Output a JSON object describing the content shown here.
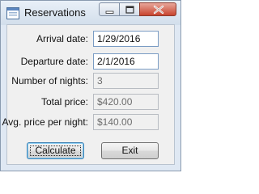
{
  "window": {
    "title": "Reservations"
  },
  "icons": {
    "app": "form-icon",
    "minimize": "minimize-icon",
    "maximize": "maximize-icon",
    "close": "close-icon"
  },
  "form": {
    "arrival_label": "Arrival date:",
    "arrival_value": "1/29/2016",
    "departure_label": "Departure date:",
    "departure_value": "2/1/2016",
    "nights_label": "Number of nights:",
    "nights_value": "3",
    "total_label": "Total price:",
    "total_value": "$420.00",
    "avg_label": "Avg. price per night:",
    "avg_value": "$140.00"
  },
  "buttons": {
    "calculate_label": "Calculate",
    "exit_label": "Exit"
  },
  "colors": {
    "window_frame": "#dfe8f3",
    "client_background": "#f0f0f0",
    "close_button": "#c8442e"
  }
}
